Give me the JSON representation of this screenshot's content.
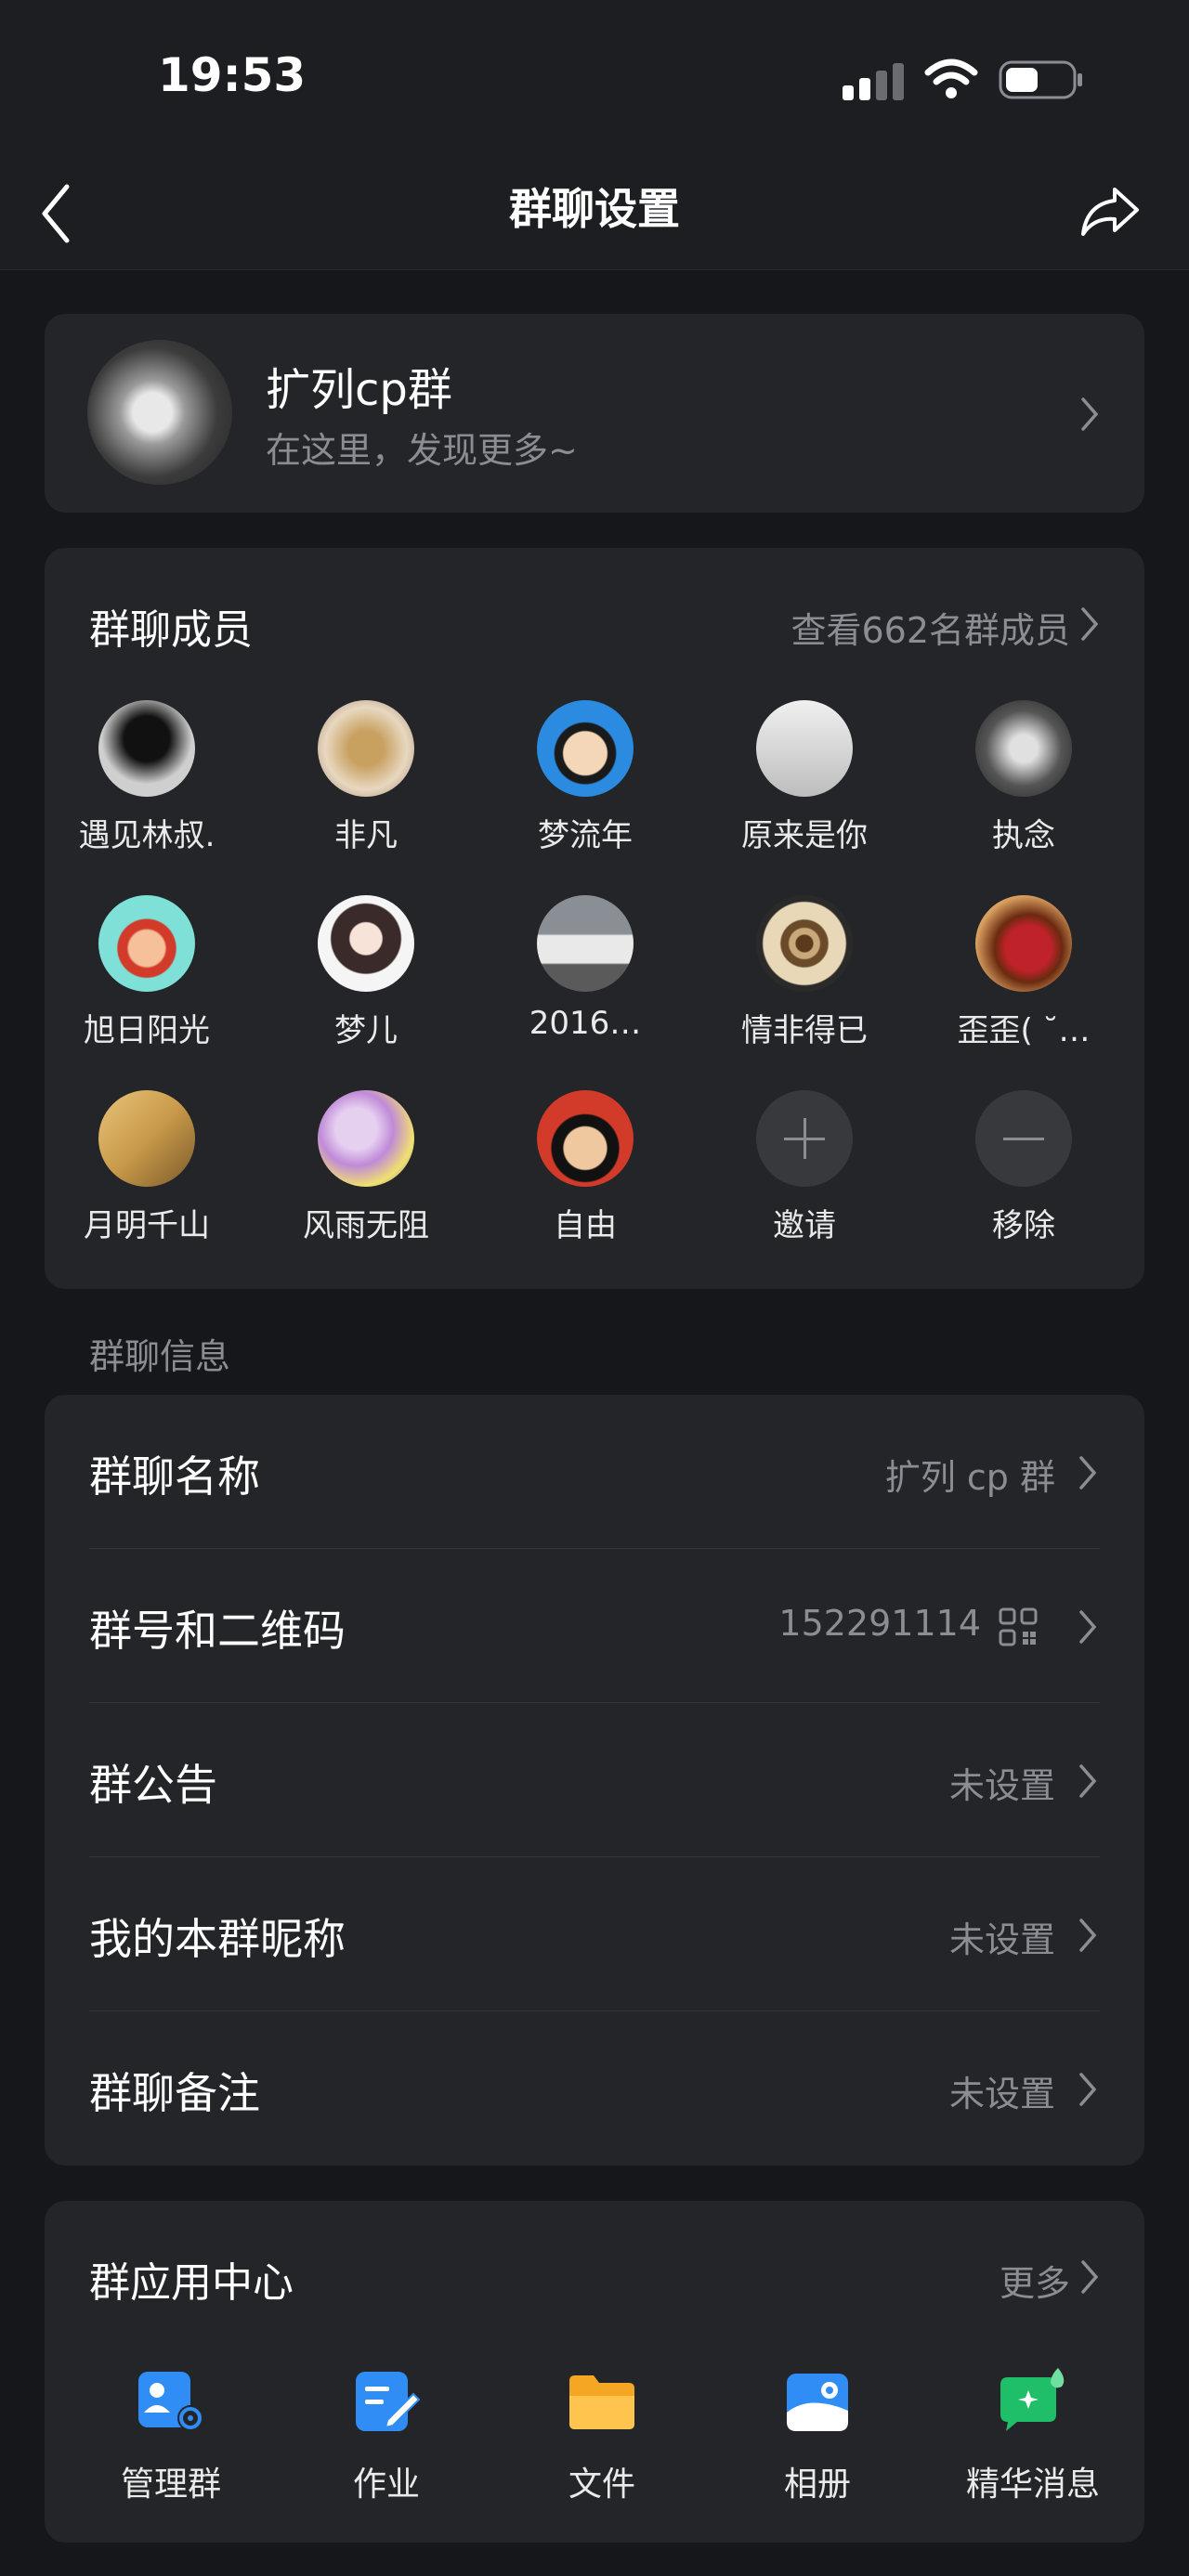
{
  "status": {
    "time": "19:53"
  },
  "nav": {
    "title": "群聊设置"
  },
  "profile": {
    "name": "扩列cp群",
    "subtitle": "在这里，发现更多~"
  },
  "members": {
    "title": "群聊成员",
    "view_all": "查看662名群成员",
    "list": [
      {
        "name": "遇见林叔."
      },
      {
        "name": "非凡"
      },
      {
        "name": "梦流年"
      },
      {
        "name": "原来是你"
      },
      {
        "name": "执念"
      },
      {
        "name": "旭日阳光"
      },
      {
        "name": "梦儿"
      },
      {
        "name": "2016…"
      },
      {
        "name": "情非得已"
      },
      {
        "name": "歪歪( ˘…"
      },
      {
        "name": "月明千山"
      },
      {
        "name": "风雨无阻"
      },
      {
        "name": "自由"
      }
    ],
    "invite_label": "邀请",
    "remove_label": "移除"
  },
  "group_info": {
    "section_label": "群聊信息",
    "rows": [
      {
        "label": "群聊名称",
        "value": "扩列 cp 群"
      },
      {
        "label": "群号和二维码",
        "value": "152291114"
      },
      {
        "label": "群公告",
        "value": "未设置"
      },
      {
        "label": "我的本群昵称",
        "value": "未设置"
      },
      {
        "label": "群聊备注",
        "value": "未设置"
      }
    ]
  },
  "apps": {
    "title": "群应用中心",
    "more": "更多",
    "items": [
      {
        "label": "管理群",
        "icon": "manage-group-icon"
      },
      {
        "label": "作业",
        "icon": "homework-icon"
      },
      {
        "label": "文件",
        "icon": "folder-icon"
      },
      {
        "label": "相册",
        "icon": "album-icon"
      },
      {
        "label": "精华消息",
        "icon": "essence-message-icon"
      }
    ]
  }
}
